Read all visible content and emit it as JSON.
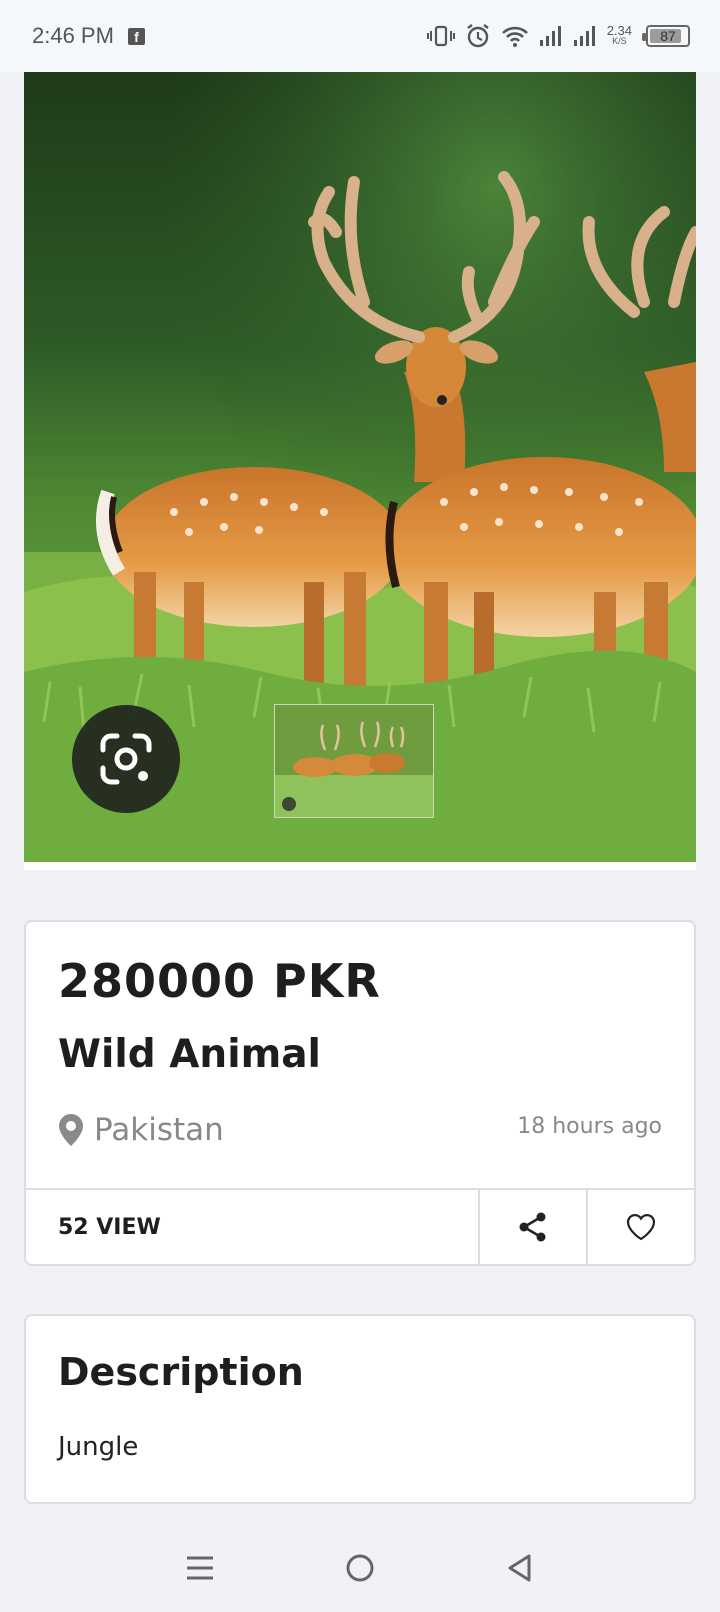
{
  "status_bar": {
    "time": "2:46 PM",
    "notification_icon": "facebook-icon",
    "net_speed_value": "2.34",
    "net_speed_unit": "K/S",
    "battery_level": "87",
    "icons": [
      "vibrate-icon",
      "alarm-icon",
      "wifi-icon",
      "signal-icon",
      "signal-icon"
    ]
  },
  "listing": {
    "image_subject": "deer in grass",
    "price": "280000 PKR",
    "title": "Wild Animal",
    "location": "Pakistan",
    "posted": "18 hours ago",
    "views": "52 VIEW"
  },
  "description": {
    "heading": "Description",
    "text": "Jungle"
  },
  "nav_bar": {
    "icons": [
      "menu-icon",
      "home-icon",
      "back-icon"
    ]
  },
  "colors": {
    "background": "#f1f2f6",
    "card": "#ffffff",
    "border": "#dcdde2",
    "muted_text": "#888888"
  }
}
